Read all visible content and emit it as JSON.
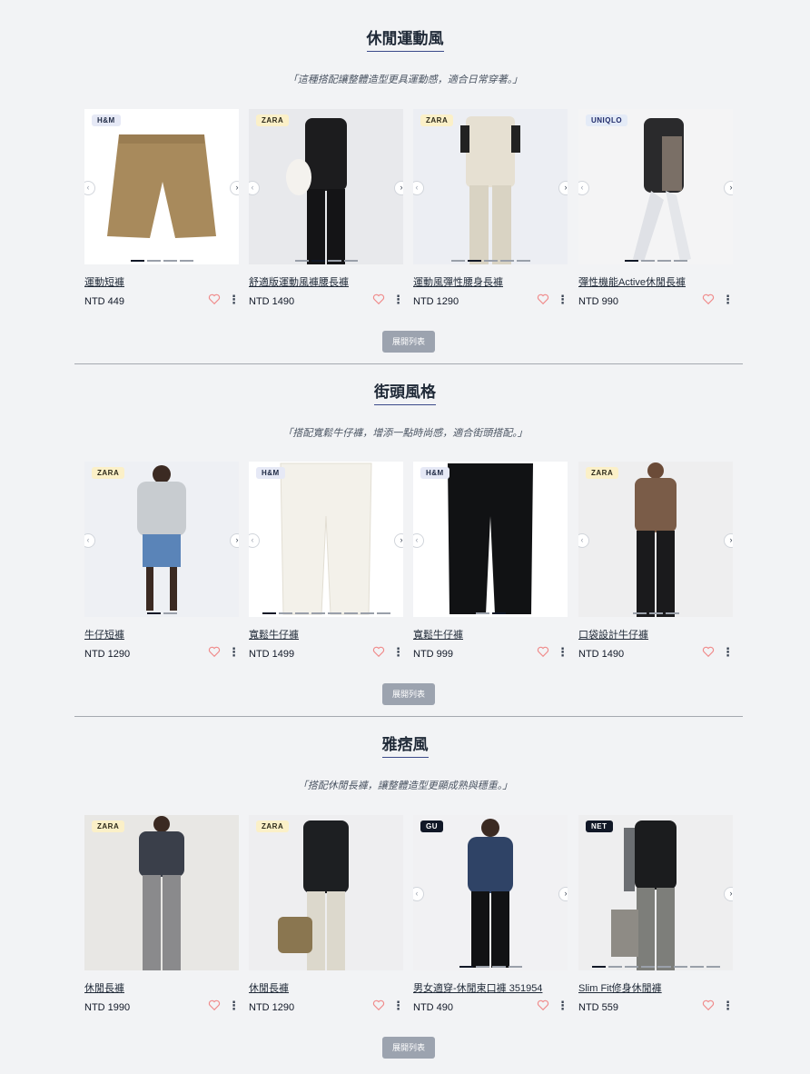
{
  "sections": [
    {
      "title": "休閒運動風",
      "description": "「這種搭配讓整體造型更具運動感，適合日常穿著。」",
      "expand_label": "展開列表",
      "products": [
        {
          "brand": "H&M",
          "name": "運動短褲",
          "price": "NTD 449"
        },
        {
          "brand": "ZARA",
          "name": "舒適版運動風褲腰長褲",
          "price": "NTD 1490"
        },
        {
          "brand": "ZARA",
          "name": "運動風彈性腰身長褲",
          "price": "NTD 1290"
        },
        {
          "brand": "UNIQLO",
          "name": "彈性機能Active休閒長褲",
          "price": "NTD 990"
        }
      ]
    },
    {
      "title": "街頭風格",
      "description": "「搭配寬鬆牛仔褲，增添一點時尚感，適合街頭搭配。」",
      "expand_label": "展開列表",
      "products": [
        {
          "brand": "ZARA",
          "name": "牛仔短褲",
          "price": "NTD 1290"
        },
        {
          "brand": "H&M",
          "name": "寬鬆牛仔褲",
          "price": "NTD 1499"
        },
        {
          "brand": "H&M",
          "name": "寬鬆牛仔褲",
          "price": "NTD 999"
        },
        {
          "brand": "ZARA",
          "name": "口袋設計牛仔褲",
          "price": "NTD 1490"
        }
      ]
    },
    {
      "title": "雅痞風",
      "description": "「搭配休閒長褲，讓整體造型更顯成熟與穩重。」",
      "expand_label": "展開列表",
      "products": [
        {
          "brand": "ZARA",
          "name": "休閒長褲",
          "price": "NTD 1990"
        },
        {
          "brand": "ZARA",
          "name": "休閒長褲",
          "price": "NTD 1290"
        },
        {
          "brand": "GU",
          "name": "男女適穿-休閒束口褲 351954",
          "price": "NTD 490"
        },
        {
          "brand": "NET",
          "name": "Slim Fit修身休閒褲",
          "price": "NTD 559"
        }
      ]
    }
  ],
  "icons": {
    "prev": "chevron-left-icon",
    "next": "chevron-right-icon",
    "favorite": "heart-icon",
    "more": "more-vertical-icon"
  },
  "colors": {
    "heart": "#f08a8a",
    "expand_button": "#9ca3af",
    "title_underline": "#3b4a8a"
  }
}
